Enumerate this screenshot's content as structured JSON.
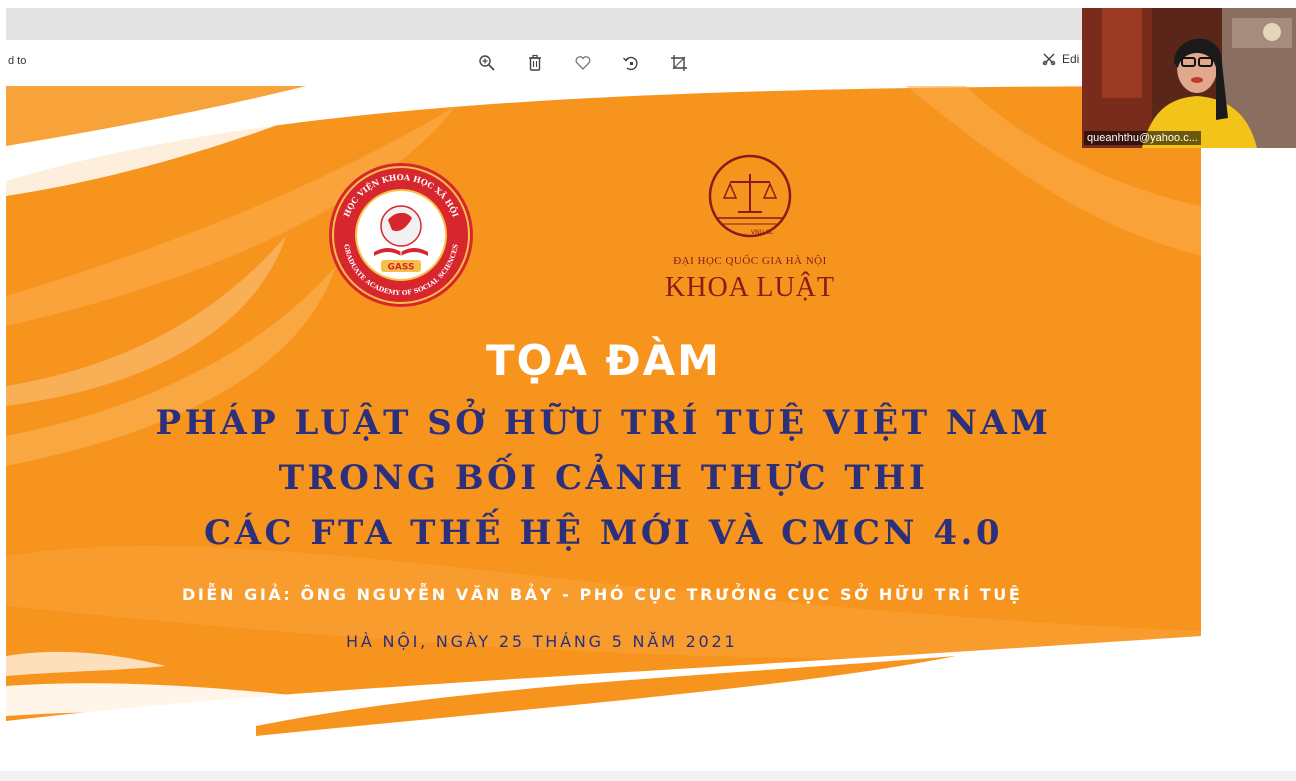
{
  "toolbar": {
    "left_text": "d to",
    "edit_label": "Edi",
    "tools": [
      {
        "name": "zoom-in-icon"
      },
      {
        "name": "delete-icon"
      },
      {
        "name": "favorite-icon"
      },
      {
        "name": "rotate-icon"
      },
      {
        "name": "crop-icon"
      }
    ]
  },
  "slide": {
    "logo_left": {
      "ring_top_text": "HỌC VIỆN KHOA HỌC XÃ HỘI",
      "ring_bottom_text": "GRADUATE ACADEMY OF SOCIAL SCIENCES",
      "badge": "GASS"
    },
    "logo_right": {
      "emblem_text": "VNU-SL",
      "line1": "ĐẠI HỌC QUỐC GIA HÀ NỘI",
      "line2": "KHOA LUẬT"
    },
    "title_main": "TỌA ĐÀM",
    "title_lines": [
      "PHÁP LUẬT SỞ HỮU TRÍ TUỆ VIỆT NAM",
      "TRONG BỐI CẢNH THỰC THI",
      "CÁC FTA THẾ HỆ MỚI VÀ CMCN 4.0"
    ],
    "speaker": "DIỄN GIẢ: ÔNG NGUYỄN VĂN BẢY -  PHÓ CỤC TRƯỞNG CỤC SỞ HỮU TRÍ TUỆ",
    "date": "HÀ NỘI, NGÀY 25 THÁNG 5 NĂM 2021"
  },
  "webcam": {
    "participant": "queanhthu@yahoo.c..."
  },
  "colors": {
    "orange": "#f7941d",
    "navy": "#2b2f7c",
    "maroon": "#8b1a1a",
    "red": "#d7262e"
  }
}
